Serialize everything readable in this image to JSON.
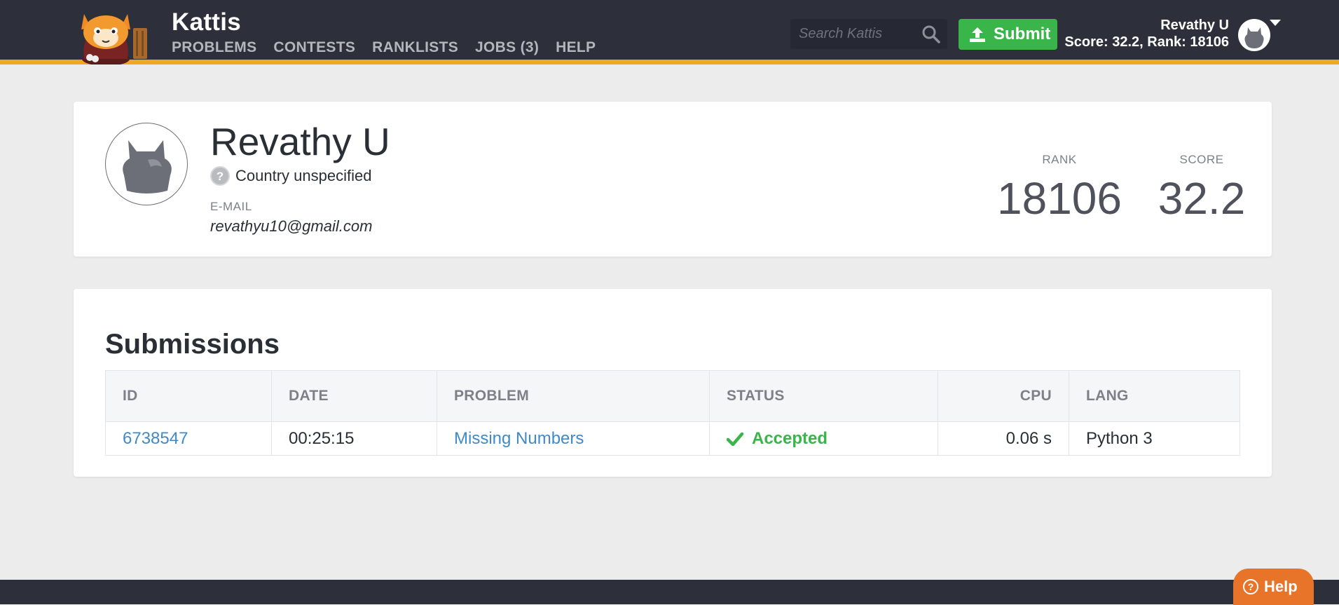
{
  "header": {
    "brand": "Kattis",
    "nav": [
      "PROBLEMS",
      "CONTESTS",
      "RANKLISTS",
      "JOBS (3)",
      "HELP"
    ],
    "search_placeholder": "Search Kattis",
    "submit_label": "Submit",
    "user_name": "Revathy U",
    "user_stats": "Score: 32.2, Rank: 18106"
  },
  "profile": {
    "name": "Revathy U",
    "country": "Country unspecified",
    "email_label": "E-MAIL",
    "email": "revathyu10@gmail.com",
    "rank_label": "RANK",
    "rank": "18106",
    "score_label": "SCORE",
    "score": "32.2"
  },
  "submissions": {
    "title": "Submissions",
    "columns": [
      "ID",
      "DATE",
      "PROBLEM",
      "STATUS",
      "CPU",
      "LANG"
    ],
    "rows": [
      {
        "id": "6738547",
        "date": "00:25:15",
        "problem": "Missing Numbers",
        "status": "Accepted",
        "cpu": "0.06 s",
        "lang": "Python 3"
      }
    ]
  },
  "footer": {
    "help_label": "Help"
  },
  "colors": {
    "header_bg": "#2d2f3a",
    "accent": "#f0a823",
    "submit_green": "#3ab54a",
    "link_blue": "#3f8ac9",
    "help_orange": "#e8742a"
  },
  "icons": [
    "kattis-cat-logo",
    "search-icon",
    "upload-icon",
    "avatar-silhouette",
    "question-icon",
    "checkmark-icon",
    "chevron-down-icon",
    "help-icon"
  ]
}
